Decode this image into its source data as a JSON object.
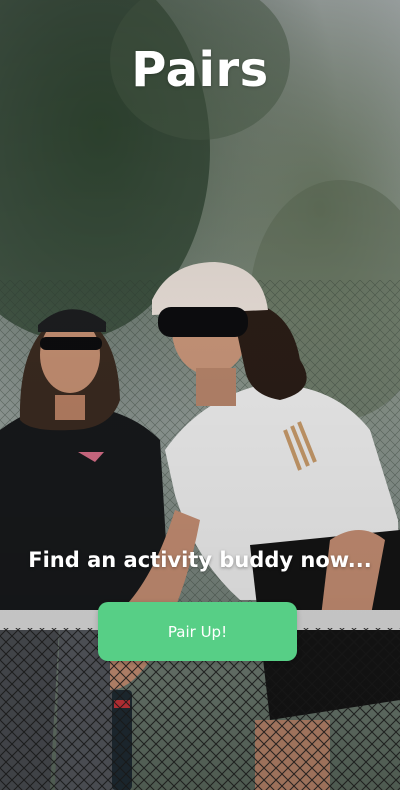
{
  "app": {
    "title": "Pairs"
  },
  "hero": {
    "tagline": "Find an activity buddy now...",
    "image_description_icon": "tennis-players-photo"
  },
  "cta": {
    "label": "Pair Up!",
    "color": "#57cf86"
  },
  "theme": {
    "text_color": "#ffffff"
  }
}
